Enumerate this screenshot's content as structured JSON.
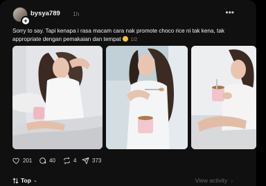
{
  "post": {
    "username": "bysya789",
    "time": "1h",
    "caption": "Sorry to say. Tapi kenapa i rasa macam cara nak promote choco rice ni tak kena, tak appropriate dengan pemakaian dan tempat",
    "page_indicator": "1/2",
    "emoji_icon": "grinning-sweat-emoji",
    "photos": [
      "photo-1",
      "photo-2",
      "photo-3"
    ]
  },
  "actions": {
    "likes": "201",
    "comments": "40",
    "reposts": "4",
    "shares": "373"
  },
  "footer": {
    "sort_label": "Top",
    "view_activity": "View activity"
  },
  "colors": {
    "background": "#101010",
    "text": "#f3f5f7",
    "muted": "#777777"
  }
}
